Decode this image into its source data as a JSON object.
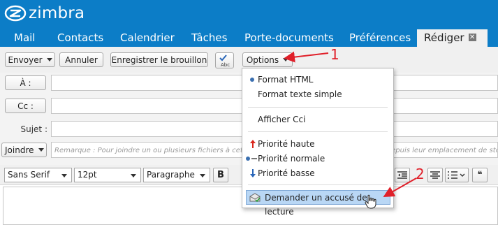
{
  "app": {
    "logo_text": "zimbra"
  },
  "tabs": [
    {
      "label": "Mail"
    },
    {
      "label": "Contacts"
    },
    {
      "label": "Calendrier"
    },
    {
      "label": "Tâches"
    },
    {
      "label": "Porte-documents"
    },
    {
      "label": "Préférences"
    },
    {
      "label": "Rédiger",
      "close": "✕"
    }
  ],
  "toolbar": {
    "send_label": "Envoyer",
    "cancel_label": "Annuler",
    "save_draft_label": "Enregistrer le brouillon",
    "spell_label": "Abc",
    "options_label": "Options"
  },
  "form": {
    "to_label": "À :",
    "cc_label": "Cc :",
    "subject_label": "Sujet :",
    "attach_label": "Joindre",
    "attach_hint": "Remarque : Pour joindre un ou plusieurs fichiers à cet e-mail, sélectionnez-les, puis glissez-les depuis leur emplacement de stockage"
  },
  "format_bar": {
    "font": "Sans Serif",
    "size": "12pt",
    "block": "Paragraphe",
    "bold": "B",
    "quote": "❝"
  },
  "options_menu": {
    "items": [
      {
        "label": "Format HTML",
        "selected": true
      },
      {
        "label": "Format texte simple",
        "selected": false
      },
      {
        "label": "Afficher Cci"
      },
      {
        "label": "Priorité haute"
      },
      {
        "label": "Priorité normale"
      },
      {
        "label": "Priorité basse"
      },
      {
        "label": "Demander un accusé de lecture"
      }
    ]
  },
  "annotations": {
    "marker_1": "1",
    "marker_2": "2"
  },
  "colors": {
    "brand": "#0c7dc7",
    "annotation": "#e0202a",
    "highlight": "#b9d7f5"
  }
}
